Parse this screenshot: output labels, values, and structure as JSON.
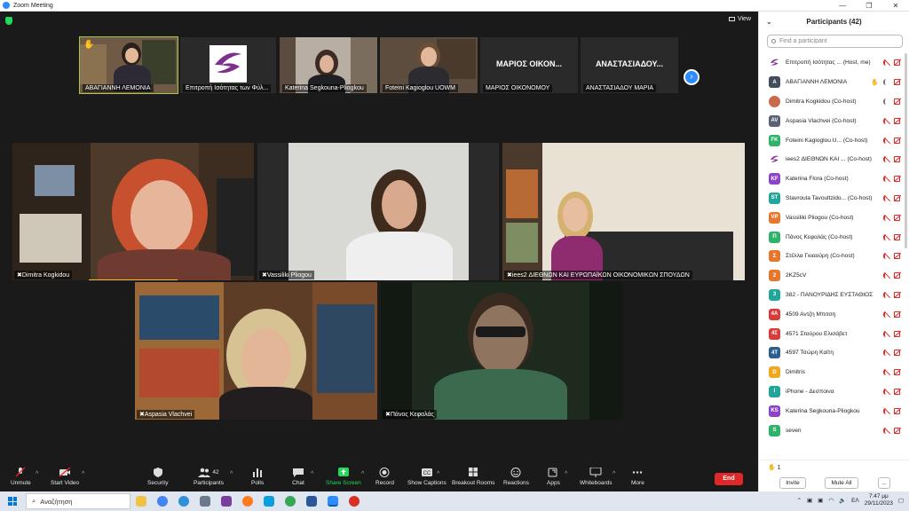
{
  "window": {
    "title": "Zoom Meeting"
  },
  "meeting": {
    "view_label": "View",
    "strip": [
      {
        "name": "ΑΒΑΓΙΑΝΝΗ ΛΕΜΟΝΙΑ",
        "type": "video"
      },
      {
        "name": "Επιτροπή Ισότητας των Φύλ...",
        "type": "logo"
      },
      {
        "name": "Katerina Segkouna-Pliogkou",
        "type": "video"
      },
      {
        "name": "Foteini Kagioglou UOWM",
        "type": "video"
      },
      {
        "name": "ΜΑΡΙΟΣ ΟΙΚΟΝΟΜΟΥ",
        "type": "text",
        "display": "ΜΑΡΙΟΣ ΟΙΚΟΝ..."
      },
      {
        "name": "ΑΝΑΣΤΑΣΙΑΔΟΥ ΜΑΡΙΑ",
        "type": "text",
        "display": "ΑΝΑΣΤΑΣΙΑΔΟΥ..."
      }
    ],
    "main": [
      {
        "name": "Dimitra Kogkidou"
      },
      {
        "name": "Vassiliki Pliogou"
      },
      {
        "name": "iees2 ΔΙΕΘΝΩΝ ΚΑΙ ΕΥΡΩΠΑΪΚΩΝ ΟΙΚΟΝΟΜΙΚΩΝ ΣΠΟΥΔΩΝ"
      },
      {
        "name": "Aspasia Vlachvei"
      },
      {
        "name": "Πάνος Κεφαλάς"
      }
    ]
  },
  "toolbar": {
    "unmute": "Unmute",
    "start_video": "Start Video",
    "security": "Security",
    "participants": "Participants",
    "participants_count": "42",
    "polls": "Polls",
    "chat": "Chat",
    "share_screen": "Share Screen",
    "record": "Record",
    "show_captions": "Show Captions",
    "breakout_rooms": "Breakout Rooms",
    "reactions": "Reactions",
    "apps": "Apps",
    "whiteboards": "Whiteboards",
    "more": "More",
    "end": "End"
  },
  "panel": {
    "title": "Participants (42)",
    "search_placeholder": "Find a participant",
    "participants": [
      {
        "initials": "",
        "name": "Επιτροπή Ισότητας ...",
        "role": "(Host, me)",
        "color": "#ffffff",
        "logo": true,
        "mic": "off"
      },
      {
        "initials": "A",
        "name": "ΑΒΑΓΙΑΝΝΗ ΛΕΜΟΝΙΑ",
        "role": "",
        "color": "#444d5c",
        "mic": "on",
        "hand": true
      },
      {
        "initials": "",
        "name": "Dimitra Kogkidou",
        "role": "(Co-host)",
        "color": "#c96a4a",
        "photo": true,
        "mic": "on"
      },
      {
        "initials": "AV",
        "name": "Aspasia Vlachvei",
        "role": "(Co-host)",
        "color": "#5b6275",
        "mic": "off"
      },
      {
        "initials": "FK",
        "name": "Foteini Kagioglou U...",
        "role": "(Co-host)",
        "color": "#2fb26a",
        "mic": "off"
      },
      {
        "initials": "",
        "name": "iees2 ΔΙΕΘΝΩΝ ΚΑΙ ...",
        "role": "(Co-host)",
        "color": "#ffffff",
        "logo": true,
        "mic": "off"
      },
      {
        "initials": "KF",
        "name": "Katerina Flora",
        "role": "(Co-host)",
        "color": "#8e44c9",
        "mic": "off"
      },
      {
        "initials": "ST",
        "name": "Stavroula Tavoultzido...",
        "role": "(Co-host)",
        "color": "#22a59a",
        "mic": "off"
      },
      {
        "initials": "VP",
        "name": "Vassiliki Pliogou",
        "role": "(Co-host)",
        "color": "#e8772e",
        "mic": "off"
      },
      {
        "initials": "Π",
        "name": "Πάνος Κεφαλάς",
        "role": "(Co-host)",
        "color": "#2fb26a",
        "mic": "off"
      },
      {
        "initials": "Σ",
        "name": "Στέλλα Γκιαούρη",
        "role": "(Co-host)",
        "color": "#e8772e",
        "mic": "off"
      },
      {
        "initials": "2",
        "name": "2KZ5cV",
        "role": "",
        "color": "#e8772e",
        "mic": "off"
      },
      {
        "initials": "3",
        "name": "382 - ΠΑΝΟΥΡΙΔΗΣ ΕΥΣΤΑΘΙΟΣ",
        "role": "",
        "color": "#22a59a",
        "mic": "off"
      },
      {
        "initials": "4A",
        "name": "4509 Αντζη Μπιτση",
        "role": "",
        "color": "#d93a3a",
        "mic": "off"
      },
      {
        "initials": "4Σ",
        "name": "4571 Σταύρου Ελισάβετ",
        "role": "",
        "color": "#d93a3a",
        "mic": "off"
      },
      {
        "initials": "4T",
        "name": "4597 Τσώρη Καίτη",
        "role": "",
        "color": "#2c5e8f",
        "mic": "off"
      },
      {
        "initials": "D",
        "name": "Dimitris",
        "role": "",
        "color": "#f0a81e",
        "mic": "off"
      },
      {
        "initials": "I",
        "name": "iPhone - Δεσποινα",
        "role": "",
        "color": "#22a59a",
        "mic": "off"
      },
      {
        "initials": "KS",
        "name": "Katerina Segkouna-Pliogkou",
        "role": "",
        "color": "#8e44c9",
        "mic": "off"
      },
      {
        "initials": "S",
        "name": "seven",
        "role": "",
        "color": "#2fb26a",
        "mic": "off"
      }
    ],
    "raised_hands": "1",
    "invite": "Invite",
    "mute_all": "Mute All",
    "more": "..."
  },
  "taskbar": {
    "search": "Αναζήτηση",
    "lang": "ΕΛ",
    "time": "7:47 μμ",
    "date": "29/11/2023"
  }
}
